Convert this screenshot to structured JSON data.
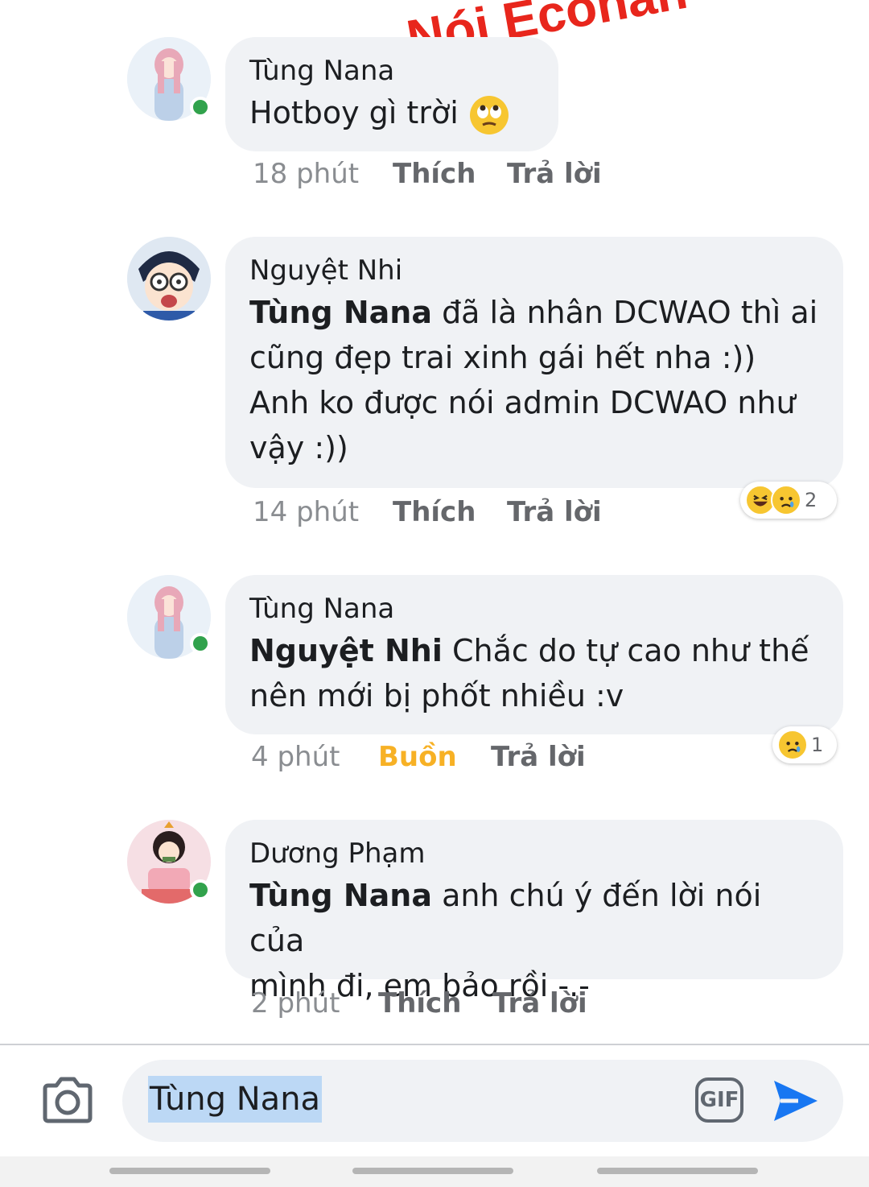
{
  "watermark": "Nói Econan",
  "comments": [
    {
      "author": "Tùng Nana",
      "mention": "",
      "text": "Hotboy gì trời",
      "emoji": "eye-roll-emoji",
      "time": "18 phút",
      "like": "Thích",
      "reply": "Trả lời",
      "online": true,
      "reactions": null
    },
    {
      "author": "Nguyệt Nhi",
      "mention": "Tùng Nana",
      "text_lines": [
        " đã là nhân DCWAO thì ai",
        "cũng đẹp trai xinh gái hết nha :))",
        "Anh ko được nói admin DCWAO như",
        "vậy :))"
      ],
      "time": "14 phút",
      "like": "Thích",
      "reply": "Trả lời",
      "online": false,
      "reactions": {
        "icons": [
          "haha-emoji",
          "sad-emoji"
        ],
        "count": "2"
      }
    },
    {
      "author": "Tùng Nana",
      "mention": "Nguyệt Nhi",
      "text_lines": [
        " Chắc do tự cao như thế",
        "nên mới bị phốt nhiều :v"
      ],
      "time": "4 phút",
      "like": "Buồn",
      "reply": "Trả lời",
      "online": true,
      "reactions": {
        "icons": [
          "sad-emoji"
        ],
        "count": "1"
      }
    },
    {
      "author": "Dương Phạm",
      "mention": "Tùng Nana",
      "text_lines": [
        " anh chú ý đến lời nói của",
        "mình đi, em bảo rồi -.-"
      ],
      "time": "2 phút",
      "like": "Thích",
      "reply": "Trả lời",
      "online": true,
      "reactions": null
    }
  ],
  "composer": {
    "value": "Tùng Nana",
    "gif_label": "GIF",
    "camera_icon": "camera-icon",
    "send_icon": "send-icon"
  },
  "colors": {
    "bubble": "#f0f2f5",
    "online": "#31a24c",
    "sad_reaction": "#f7b125",
    "send": "#1877f2",
    "watermark": "#e8261c"
  }
}
